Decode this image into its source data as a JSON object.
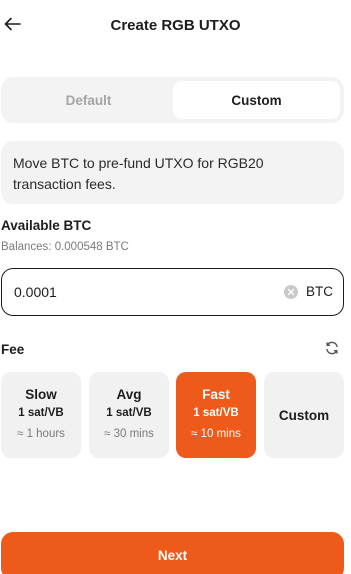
{
  "header": {
    "title": "Create RGB UTXO",
    "back_icon": "arrow-left-icon"
  },
  "mode_tabs": [
    {
      "label": "Default",
      "selected": false
    },
    {
      "label": "Custom",
      "selected": true
    }
  ],
  "info": {
    "text": "Move BTC to pre-fund UTXO for RGB20 transaction fees."
  },
  "available": {
    "title": "Available BTC",
    "balances": "Balances: 0.000548 BTC"
  },
  "amount": {
    "value": "0.0001",
    "unit": "BTC",
    "clear_icon": "clear-circle-icon"
  },
  "fee": {
    "title": "Fee",
    "refresh_icon": "refresh-icon",
    "options": [
      {
        "name": "Slow",
        "rate": "1 sat/VB",
        "eta": "≈ 1 hours",
        "selected": false
      },
      {
        "name": "Avg",
        "rate": "1 sat/VB",
        "eta": "≈ 30 mins",
        "selected": false
      },
      {
        "name": "Fast",
        "rate": "1 sat/VB",
        "eta": "≈ 10 mins",
        "selected": true
      }
    ],
    "custom_label": "Custom"
  },
  "next_button": {
    "label": "Next"
  },
  "colors": {
    "accent": "#ee5a1a",
    "card_bg": "#f1f1f1",
    "text": "#1d1d1d",
    "muted": "#7a7a7a"
  }
}
